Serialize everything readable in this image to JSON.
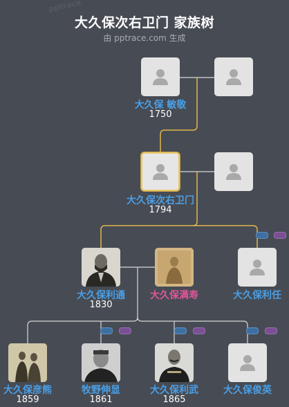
{
  "header": {
    "title": "大久保次右卫门 家族树",
    "subtitle": "由 pptrace.com 生成",
    "watermark": "pptrace"
  },
  "colors": {
    "background": "#474b53",
    "male_name": "#4a9fe6",
    "female_name": "#e0569b",
    "line_gold": "#e0b84a",
    "line_white": "#d8d8d8",
    "selected_border": "#e8c86a"
  },
  "generations": {
    "g1": [
      {
        "name": "大久保 敏敬",
        "year": "1750",
        "photo": false
      },
      {
        "name": "",
        "year": "",
        "photo": false
      }
    ],
    "g2": [
      {
        "name": "大久保次右卫门",
        "year": "1794",
        "photo": false,
        "selected": true
      },
      {
        "name": "",
        "year": "",
        "photo": false
      }
    ],
    "g3": [
      {
        "name": "大久保利通",
        "year": "1830",
        "photo": true
      },
      {
        "name": "大久保满寿",
        "year": "",
        "photo": true,
        "gender": "female"
      },
      {
        "name": "大久保利任",
        "year": "",
        "photo": false
      }
    ],
    "g4": [
      {
        "name": "大久保彦熊",
        "year": "1859",
        "photo": true
      },
      {
        "name": "牧野伸显",
        "year": "1861",
        "photo": true
      },
      {
        "name": "大久保利武",
        "year": "1865",
        "photo": true
      },
      {
        "name": "大久保俊英",
        "year": "",
        "photo": false
      }
    ]
  }
}
